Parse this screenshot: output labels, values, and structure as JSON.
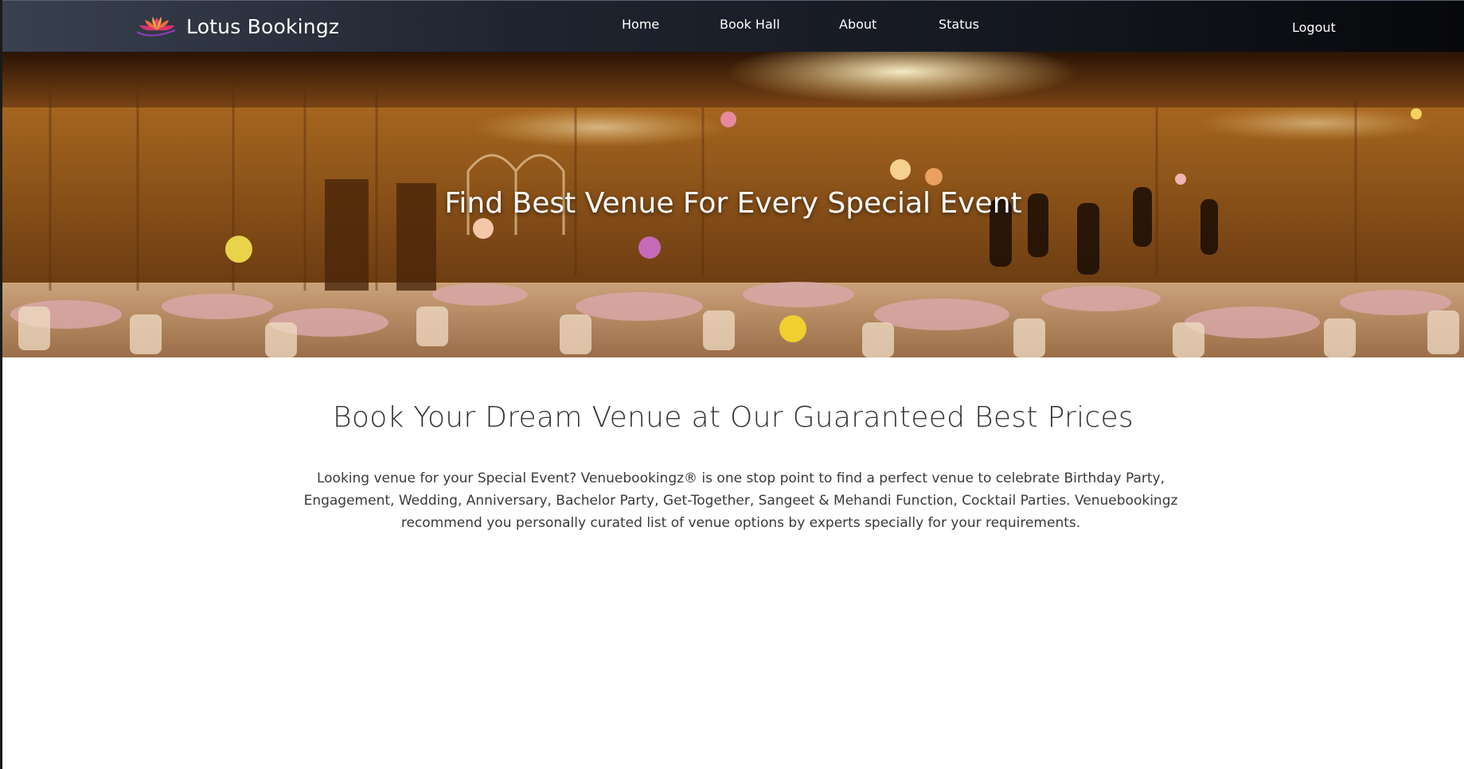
{
  "navbar": {
    "brand": "Lotus Bookingz",
    "logo_icon": "lotus-logo-icon",
    "links": [
      {
        "label": "Home"
      },
      {
        "label": "Book Hall"
      },
      {
        "label": "About"
      },
      {
        "label": "Status"
      }
    ],
    "logout_label": "Logout"
  },
  "hero": {
    "title": "Find Best Venue For Every Special Event",
    "image": "banquet-hall-photo"
  },
  "intro": {
    "heading": "Book Your Dream Venue at Our Guaranteed Best Prices",
    "text": "Looking venue for your Special Event? Venuebookingz® is one stop point to find a perfect venue to celebrate Birthday Party, Engagement, Wedding, Anniversary, Bachelor Party, Get-Together, Sangeet & Mehandi Function, Cocktail Parties. Venuebookingz recommend you personally curated list of venue options by experts specially for your requirements."
  },
  "colors": {
    "navbar_start": "#39404f",
    "navbar_end": "#07080b",
    "hero_tone": "#b06a24",
    "heading_text": "#333333",
    "body_text": "#3a3a3a"
  }
}
